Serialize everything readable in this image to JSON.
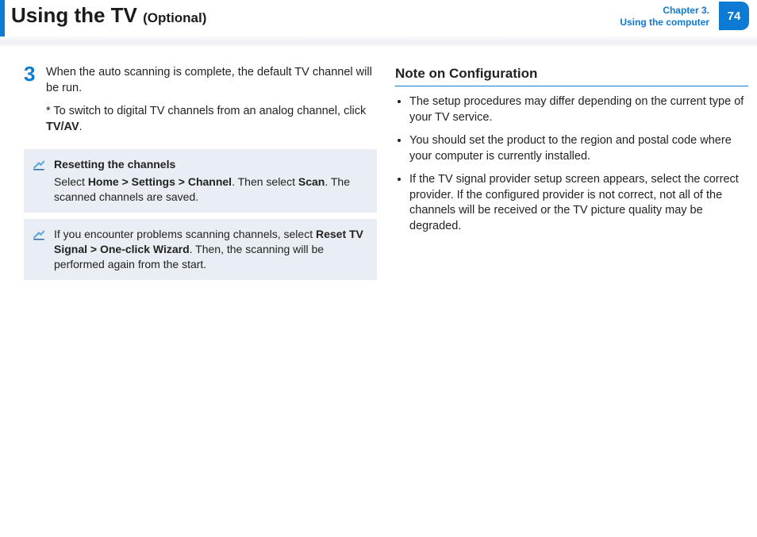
{
  "header": {
    "title_main": "Using the TV",
    "title_sub": "(Optional)",
    "chapter_line1": "Chapter 3.",
    "chapter_line2": "Using the computer",
    "page_number": "74"
  },
  "left": {
    "step_number": "3",
    "step_line1": "When the auto scanning is complete, the default TV channel will be run.",
    "step_note_prefix": "* To switch to digital TV channels from an analog channel, click ",
    "step_note_bold": "TV/AV",
    "step_note_suffix": ".",
    "box1_title": "Resetting the channels",
    "box1_p1a": "Select ",
    "box1_p1b": "Home > Settings > Channel",
    "box1_p1c": ". Then select ",
    "box1_p1d": "Scan",
    "box1_p1e": ". The scanned channels are saved.",
    "box2_p1a": "If you encounter problems scanning channels, select ",
    "box2_p1b": "Reset TV Signal > One-click Wizard",
    "box2_p1c": ". Then, the scanning will be performed again from the start."
  },
  "right": {
    "section_title": "Note on Configuration",
    "bullets": [
      "The setup procedures may differ depending on the current type of your TV service.",
      "You should set the product to the region and postal code where your computer is currently installed.",
      "If the TV signal provider setup screen appears, select the correct provider. If the configured provider is not correct, not all of the channels will be received or the TV picture quality may be degraded."
    ]
  }
}
